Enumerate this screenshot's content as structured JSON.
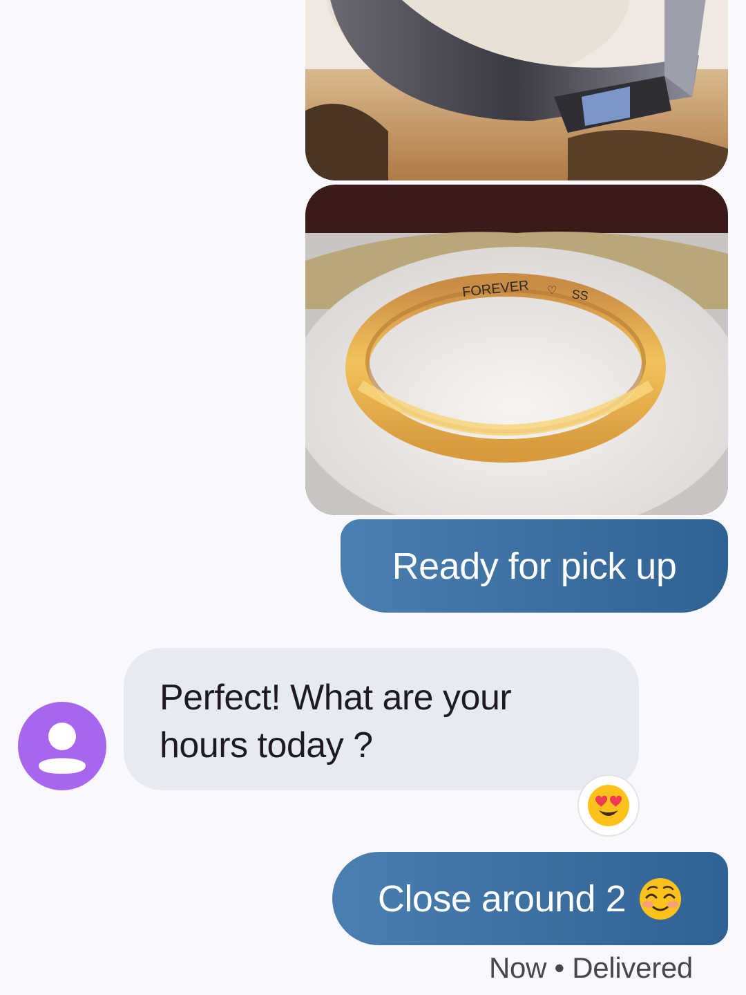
{
  "messages": {
    "image1": {
      "alt": "Photo of ring"
    },
    "image2": {
      "alt": "Photo of engraved ring",
      "engraving_left": "FOREVER",
      "engraving_right": "SS"
    },
    "outgoing1": {
      "text": "Ready for pick up"
    },
    "incoming1": {
      "line1": "Perfect! What are your",
      "line2": "hours today ?",
      "reaction": "heart-eyes-emoji"
    },
    "outgoing2": {
      "text": "Close around 2",
      "emoji": "smiling-face-emoji"
    }
  },
  "status": {
    "time": "Now",
    "separator": "•",
    "state": "Delivered"
  },
  "colors": {
    "outgoing_start": "#4a7fb0",
    "outgoing_end": "#2f6293",
    "incoming_bg": "#e6eaf2",
    "avatar_bg": "#a866ef",
    "background": "#f9f8fd"
  }
}
